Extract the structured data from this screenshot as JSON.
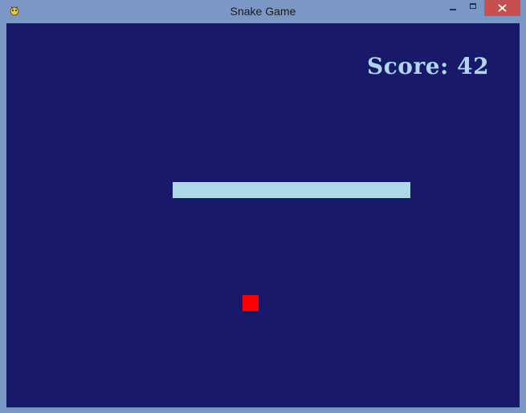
{
  "window": {
    "title": "Snake Game",
    "app_icon": "pygame-snake-icon"
  },
  "controls": {
    "minimize_icon": "minimize-icon",
    "maximize_icon": "maximize-icon",
    "close_icon": "close-icon"
  },
  "game": {
    "score_text": "Score: 42",
    "background_color": "#18196a",
    "snake_color": "#add8e6",
    "food_color": "#ff0000",
    "score_color": "#aed8ea"
  }
}
